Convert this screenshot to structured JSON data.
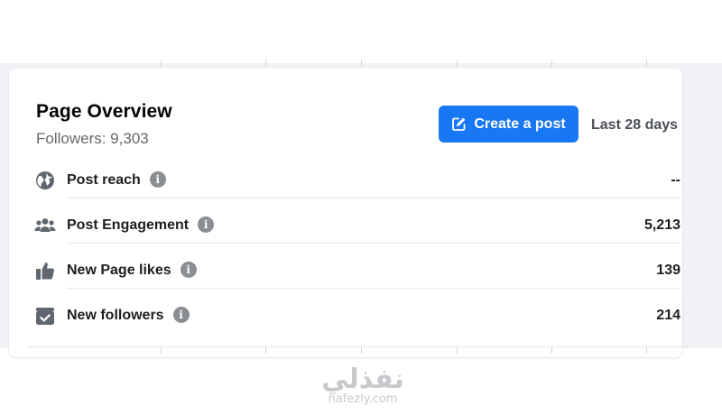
{
  "overview": {
    "title": "Page Overview",
    "followers_text": "Followers: 9,303",
    "create_post_label": "Create a post",
    "date_range": "Last 28 days"
  },
  "metrics": [
    {
      "label": "Post reach",
      "value": "--",
      "icon": "globe-icon"
    },
    {
      "label": "Post Engagement",
      "value": "5,213",
      "icon": "people-icon"
    },
    {
      "label": "New Page likes",
      "value": "139",
      "icon": "thumbs-up-icon"
    },
    {
      "label": "New followers",
      "value": "214",
      "icon": "follow-check-icon"
    }
  ],
  "info_glyph": "i",
  "watermark": {
    "arabic": "نفذلي",
    "url": "nafezly.com"
  },
  "colors": {
    "accent": "#1877f2",
    "text_primary": "#1c1e21",
    "text_secondary": "#65676b",
    "icon_gray": "#606770",
    "info_gray": "#8a8d91",
    "divider": "#e4e6eb",
    "backdrop": "#f0f2f5"
  }
}
